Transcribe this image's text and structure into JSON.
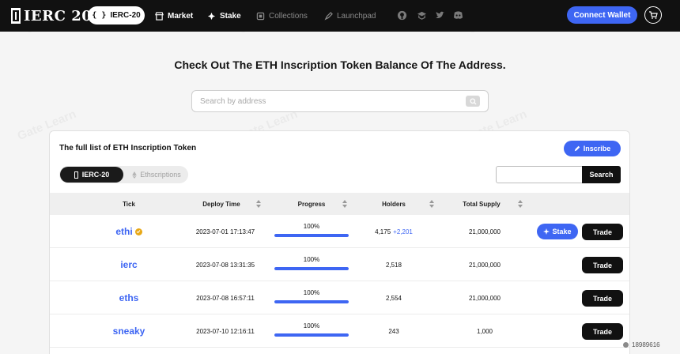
{
  "nav": {
    "logo": "IERC 20",
    "active_tab": "IERC-20",
    "items": [
      "Market",
      "Stake",
      "Collections",
      "Launchpad"
    ],
    "connect": "Connect Wallet"
  },
  "page": {
    "headline": "Check Out The ETH Inscription Token Balance Of The Address.",
    "search_placeholder": "Search by address"
  },
  "card": {
    "title": "The full list of ETH Inscription Token",
    "inscribe": "Inscribe",
    "tabs": [
      "IERC-20",
      "Ethscriptions"
    ],
    "search_label": "Search"
  },
  "table": {
    "headers": [
      "Tick",
      "Deploy Time",
      "Progress",
      "Holders",
      "Total Supply"
    ],
    "rows": [
      {
        "tick": "ethi",
        "time": "2023-07-01 17:13:47",
        "progress": "100%",
        "holders": "4,175",
        "delta": "+2,201",
        "supply": "21,000,000"
      },
      {
        "tick": "ierc",
        "time": "2023-07-08 13:31:35",
        "progress": "100%",
        "holders": "2,518",
        "supply": "21,000,000"
      },
      {
        "tick": "eths",
        "time": "2023-07-08 16:57:11",
        "progress": "100%",
        "holders": "2,554",
        "supply": "21,000,000"
      },
      {
        "tick": "sneaky",
        "time": "2023-07-10 12:16:11",
        "progress": "100%",
        "holders": "243",
        "supply": "1,000"
      }
    ],
    "stake_label": "Stake",
    "trade_label": "Trade"
  },
  "watermark": "Gate Learn",
  "badge_id": "18989616",
  "colors": {
    "accent": "#3e66f3",
    "nav_bg": "#111111",
    "verified": "#e8a817"
  }
}
